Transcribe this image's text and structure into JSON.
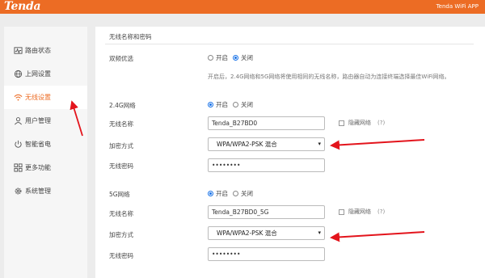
{
  "header": {
    "logo": "Tenda",
    "app_link": "Tenda WiFi APP"
  },
  "sidebar": {
    "items": [
      {
        "label": "路由状态",
        "icon": "pulse-icon"
      },
      {
        "label": "上网设置",
        "icon": "globe-icon"
      },
      {
        "label": "无线设置",
        "icon": "wifi-icon"
      },
      {
        "label": "用户管理",
        "icon": "user-icon"
      },
      {
        "label": "智能省电",
        "icon": "power-icon"
      },
      {
        "label": "更多功能",
        "icon": "grid-icon"
      },
      {
        "label": "系统管理",
        "icon": "gear-icon"
      }
    ]
  },
  "main": {
    "section_title": "无线名称和密码",
    "dual_band": {
      "label": "双频优选",
      "on": "开启",
      "off": "关闭",
      "selected": "off",
      "note": "开启后，2.4G网络和5G网络将使用相同的无线名称，路由器自动为连接终端选择最佳WiFi网络。"
    },
    "band_24": {
      "label": "2.4G网络",
      "on": "开启",
      "off": "关闭",
      "ssid_label": "无线名称",
      "ssid": "Tenda_B27BD0",
      "hide_label": "隐藏网络",
      "help": "(?)",
      "enc_label": "加密方式",
      "enc": "WPA/WPA2-PSK 混合",
      "pwd_label": "无线密码",
      "pwd": "••••••••"
    },
    "band_5": {
      "label": "5G网络",
      "on": "开启",
      "off": "关闭",
      "ssid_label": "无线名称",
      "ssid": "Tenda_B27BD0_5G",
      "hide_label": "隐藏网络",
      "help": "(?)",
      "enc_label": "加密方式",
      "enc": "WPA/WPA2-PSK 混合",
      "pwd_label": "无线密码",
      "pwd": "••••••••"
    }
  },
  "colors": {
    "accent": "#ec6c24",
    "radio": "#1a73e8",
    "arrow": "#e3141c"
  }
}
